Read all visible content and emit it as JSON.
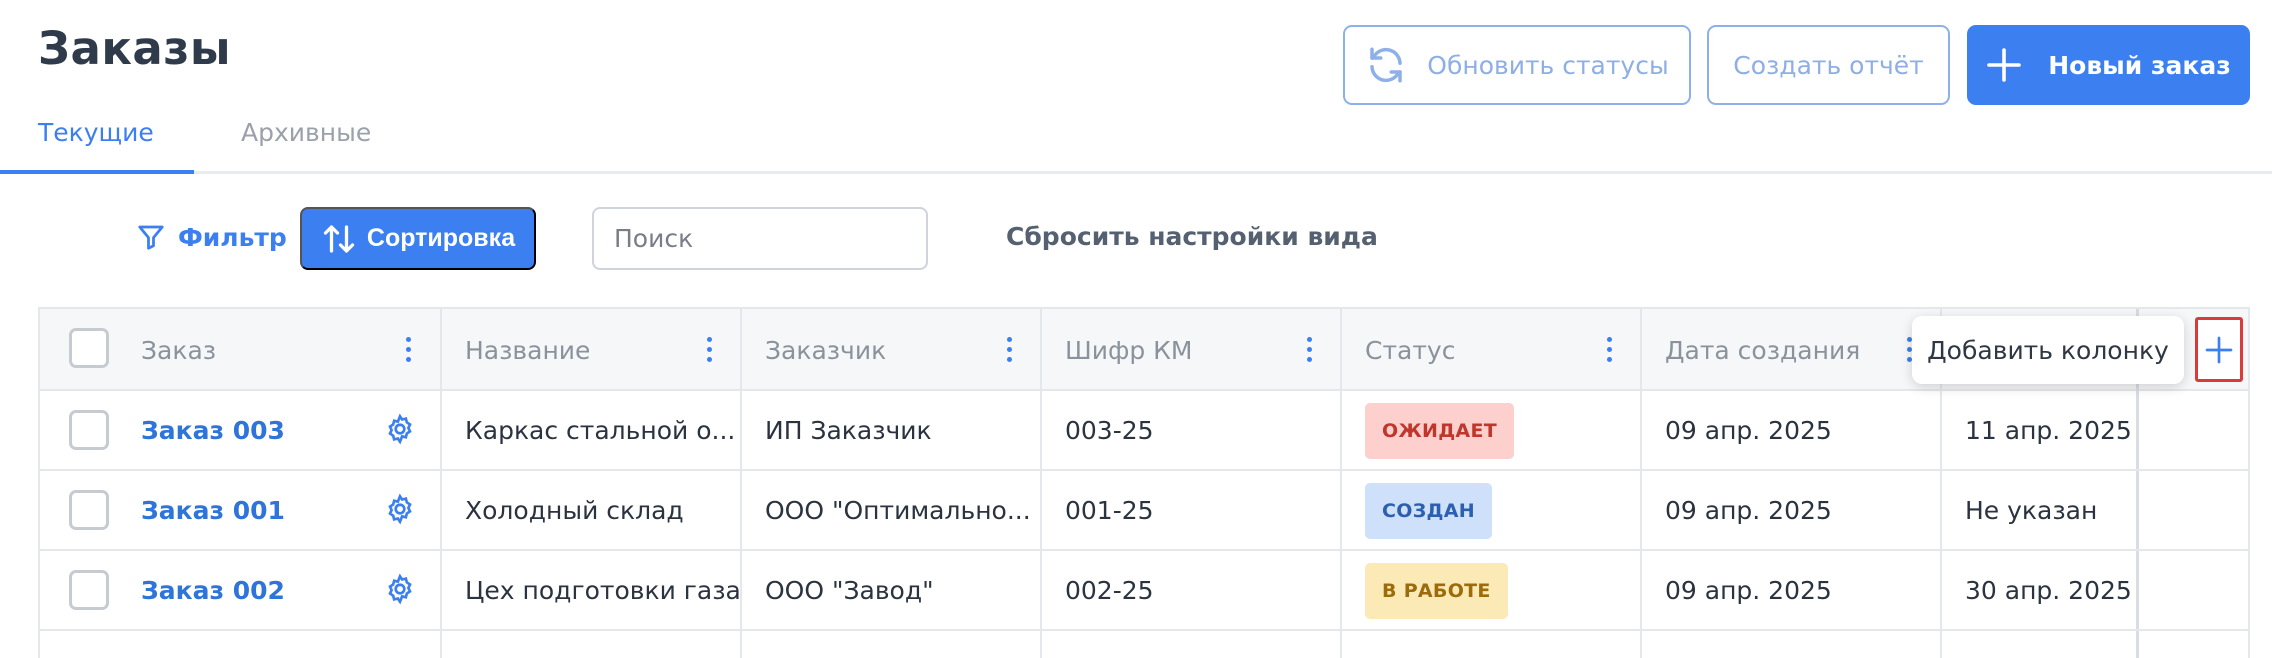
{
  "page": {
    "title": "Заказы"
  },
  "header": {
    "refresh_label": "Обновить статусы",
    "report_label": "Создать отчёт",
    "new_order_label": "Новый заказ"
  },
  "tabs": [
    {
      "label": "Текущие",
      "active": true
    },
    {
      "label": "Архивные",
      "active": false
    }
  ],
  "toolbar": {
    "filter_label": "Фильтр",
    "sort_label": "Сортировка",
    "search_placeholder": "Поиск",
    "search_value": "",
    "reset_label": "Сбросить настройки вида"
  },
  "table": {
    "columns": [
      "Заказ",
      "Название",
      "Заказчик",
      "Шифр КМ",
      "Статус",
      "Дата создания",
      ""
    ],
    "rows": [
      {
        "order": "Заказ 003",
        "name": "Каркас стальной о...",
        "customer": "ИП Заказчик",
        "code": "003-25",
        "status": "ОЖИДАЕТ",
        "status_kind": "waiting",
        "created": "09 апр. 2025",
        "deadline": "11 апр. 2025"
      },
      {
        "order": "Заказ 001",
        "name": "Холодный склад",
        "customer": "ООО \"Оптимально...",
        "code": "001-25",
        "status": "СОЗДАН",
        "status_kind": "created",
        "created": "09 апр. 2025",
        "deadline": "Не указан"
      },
      {
        "order": "Заказ 002",
        "name": "Цех подготовки газа",
        "customer": "ООО \"Завод\"",
        "code": "002-25",
        "status": "В РАБОТЕ",
        "status_kind": "in_progress",
        "created": "09 апр. 2025",
        "deadline": "30 апр. 2025"
      }
    ],
    "add_column_tooltip": "Добавить колонку"
  },
  "colors": {
    "accent": "#3b7ff0",
    "status_waiting_bg": "#fdcfcd",
    "status_waiting_fg": "#c0362c",
    "status_created_bg": "#cfe0fa",
    "status_created_fg": "#2c5fad",
    "status_in_progress_bg": "#fbe9b6",
    "status_in_progress_fg": "#9b6b0c",
    "add_column_highlight": "#d93a3a"
  },
  "icons": {
    "refresh": "refresh-icon",
    "plus": "plus-icon",
    "filter": "filter-icon",
    "sort": "sort-icon",
    "gear": "gear-icon",
    "kebab": "kebab-menu-icon"
  }
}
